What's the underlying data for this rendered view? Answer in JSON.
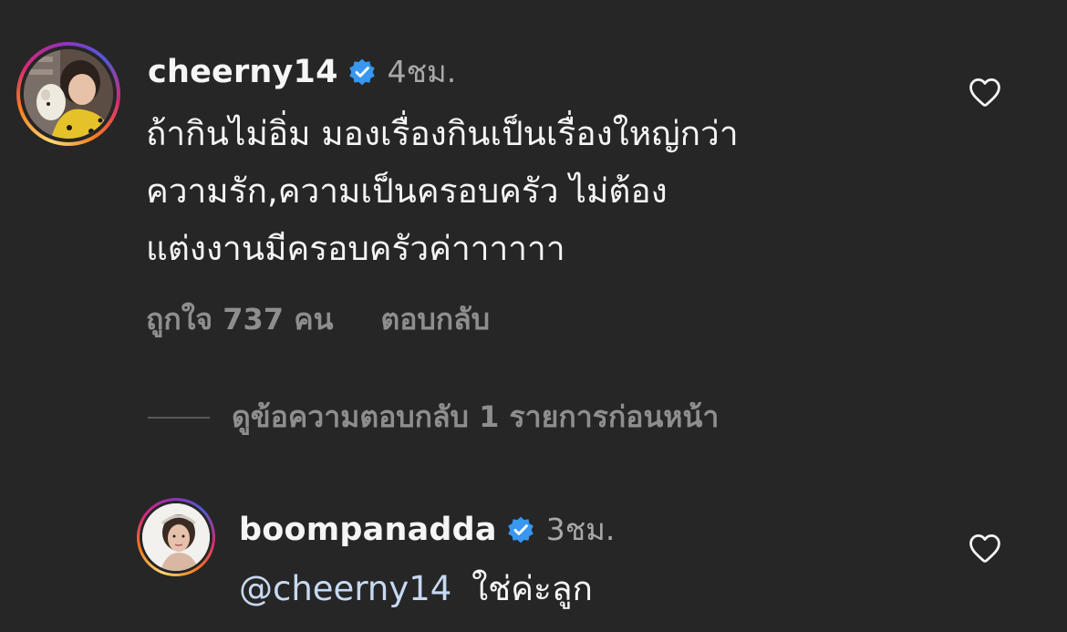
{
  "comment": {
    "username": "cheerny14",
    "time": "4ชม.",
    "lines": [
      "ถ้ากินไม่อิ่ม มองเรื่องกินเป็นเรื่องใหญ่กว่า",
      "ความรัก,ความเป็นครอบครัว ไม่ต้อง",
      "แต่งงานมีครอบครัวค่าาาาาา"
    ],
    "likes_label": "ถูกใจ 737 คน",
    "reply_label": "ตอบกลับ"
  },
  "view_replies_label": "ดูข้อความตอบกลับ 1 รายการก่อนหน้า",
  "reply": {
    "username": "boompanadda",
    "time": "3ชม.",
    "mention": "@cheerny14",
    "text": "ใช่ค่ะลูก"
  },
  "colors": {
    "background": "#262626",
    "verified": "#3897f0",
    "muted": "#8e8e8e",
    "mention": "#c7d9f2"
  }
}
